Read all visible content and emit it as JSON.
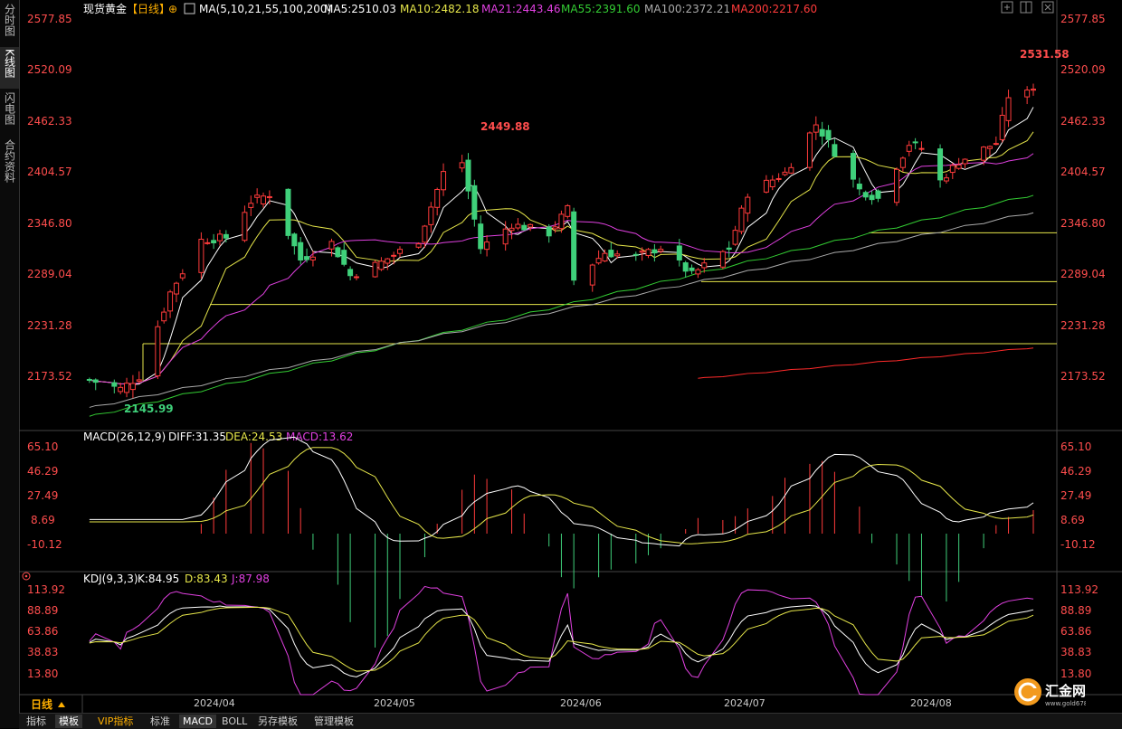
{
  "sidebar": {
    "tabs": [
      {
        "label": "分时图",
        "active": false
      },
      {
        "label": "K线图",
        "active": true
      },
      {
        "label": "闪电图",
        "active": false
      },
      {
        "label": "合约资料",
        "active": false
      }
    ]
  },
  "header": {
    "symbol": "现货黄金",
    "period": "【日线】",
    "ma_params": "MA(5,10,21,55,100,200)",
    "ma5": "MA5:2510.03",
    "ma10": "MA10:2482.18",
    "ma21": "MA21:2443.46",
    "ma55": "MA55:2391.60",
    "ma100": "MA100:2372.21",
    "ma200": "MA200:2217.60"
  },
  "price_axis": [
    "2577.85",
    "2520.09",
    "2462.33",
    "2404.57",
    "2346.80",
    "2289.04",
    "2231.28",
    "2173.52"
  ],
  "annotations": {
    "high1": "2449.88",
    "high2": "2531.58",
    "low1": "2145.99"
  },
  "macd": {
    "title": "MACD(26,12,9)",
    "diff": "DIFF:31.35",
    "dea": "DEA:24.53",
    "macd": "MACD:13.62",
    "axis": [
      "65.10",
      "46.29",
      "27.49",
      "8.69",
      "-10.12"
    ]
  },
  "kdj": {
    "title": "KDJ(9,3,3)",
    "k": "K:84.95",
    "d": "D:83.43",
    "j": "J:87.98",
    "axis": [
      "113.92",
      "88.89",
      "63.86",
      "38.83",
      "13.80"
    ]
  },
  "time_axis": {
    "period_label": "日线",
    "months": [
      "2024/04",
      "2024/05",
      "2024/06",
      "2024/07",
      "2024/08"
    ]
  },
  "bottom_tabs": [
    {
      "label": "指标",
      "active": false
    },
    {
      "label": "模板",
      "active": true
    },
    {
      "label": "VIP指标",
      "active": false,
      "vip": true
    },
    {
      "label": "标准",
      "active": false
    },
    {
      "label": "MACD",
      "active": true
    },
    {
      "label": "BOLL",
      "active": false
    },
    {
      "label": "另存模板",
      "active": false
    },
    {
      "label": "管理模板",
      "active": false
    }
  ],
  "logo": {
    "name": "汇金网",
    "url_text": "www.gold678.com"
  },
  "colors": {
    "up": "#ff3b3b",
    "down": "#3fd07a",
    "ma5": "#ffffff",
    "ma10": "#e6e64a",
    "ma21": "#e040e0",
    "ma55": "#33cc33",
    "ma100": "#aaaaaa",
    "ma200": "#ff2a2a",
    "axis_text": "#ff4d4d",
    "hline": "#e6e64a"
  },
  "chart_data": {
    "type": "candlestick",
    "title": "现货黄金【日线】",
    "ylim": [
      2130,
      2590
    ],
    "x_range": [
      "2024/03/20",
      "2024/08/20"
    ],
    "horizontal_levels": [
      2347.3,
      2292.2,
      2266.3,
      2222.0
    ],
    "close_path": [
      [
        "2024-03-21",
        2181
      ],
      [
        "2024-03-26",
        2171
      ],
      [
        "2024-03-29",
        2185
      ],
      [
        "2024-04-03",
        2280
      ],
      [
        "2024-04-08",
        2339
      ],
      [
        "2024-04-12",
        2342
      ],
      [
        "2024-04-16",
        2383
      ],
      [
        "2024-04-19",
        2391
      ],
      [
        "2024-04-24",
        2317
      ],
      [
        "2024-04-29",
        2336
      ],
      [
        "2024-05-02",
        2299
      ],
      [
        "2024-05-07",
        2314
      ],
      [
        "2024-05-13",
        2339
      ],
      [
        "2024-05-17",
        2415
      ],
      [
        "2024-05-20",
        2427
      ],
      [
        "2024-05-23",
        2330
      ],
      [
        "2024-05-28",
        2357
      ],
      [
        "2024-06-03",
        2347
      ],
      [
        "2024-06-06",
        2374
      ],
      [
        "2024-06-07",
        2294
      ],
      [
        "2024-06-12",
        2325
      ],
      [
        "2024-06-17",
        2320
      ],
      [
        "2024-06-21",
        2331
      ],
      [
        "2024-06-26",
        2300
      ],
      [
        "2024-07-02",
        2330
      ],
      [
        "2024-07-05",
        2392
      ],
      [
        "2024-07-11",
        2415
      ],
      [
        "2024-07-16",
        2470
      ],
      [
        "2024-07-17",
        2460
      ],
      [
        "2024-07-23",
        2396
      ],
      [
        "2024-07-26",
        2386
      ],
      [
        "2024-07-31",
        2448
      ],
      [
        "2024-08-02",
        2443
      ],
      [
        "2024-08-05",
        2406
      ],
      [
        "2024-08-08",
        2428
      ],
      [
        "2024-08-14",
        2449
      ],
      [
        "2024-08-16",
        2502
      ],
      [
        "2024-08-19",
        2505
      ],
      [
        "2024-08-20",
        2513
      ]
    ],
    "ma_series": [
      {
        "name": "MA5",
        "last": 2510.03
      },
      {
        "name": "MA10",
        "last": 2482.18
      },
      {
        "name": "MA21",
        "last": 2443.46
      },
      {
        "name": "MA55",
        "last": 2391.6
      },
      {
        "name": "MA100",
        "last": 2372.21
      },
      {
        "name": "MA200",
        "last": 2217.6
      }
    ]
  }
}
